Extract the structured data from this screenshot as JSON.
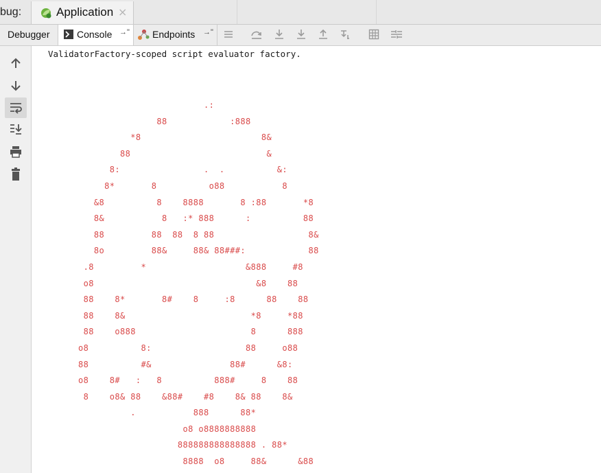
{
  "topbar": {
    "debug_label": "bug:",
    "run_tab_label": "Application",
    "close_glyph": "×"
  },
  "toolbar": {
    "debugger_label": "Debugger",
    "console_label": "Console",
    "endpoints_label": "Endpoints",
    "pin_glyph": "→\""
  },
  "console": {
    "first_line": "ValidatorFactory-scoped script evaluator factory.",
    "art_color": "#d94a4a",
    "art_lines": [
      "                        .:",
      "               88            :888",
      "          *8                       8&",
      "        88                          &",
      "      8:                .  .          &:",
      "     8*       8          o88           8",
      "   &8          8    8888       8 :88       *8",
      "   8&           8   :* 888      :          88",
      "   88         88  88  8 88                  8&",
      "   8o         88&     88& 88###:            88",
      " .8         *                   &888     #8",
      " o8                               &8    88",
      " 88    8*       8#    8     :8      88    88",
      " 88    8&                        *8     *88",
      " 88    o888                      8      888",
      "o8          8:                  88     o88",
      "88          #&               88#      &8:",
      "o8    8#   :   8          888#     8    88",
      " 8    o8& 88    &88#    #8    8& 88    8&",
      "          .           888      88*",
      "                    o8 o8888888888",
      "                   888888888888888 . 88*",
      "                    8888  o8     88&      &88"
    ]
  }
}
